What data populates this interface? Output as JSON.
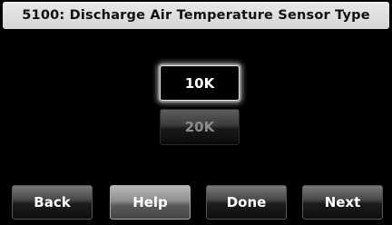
{
  "header": {
    "title": "5100: Discharge Air Temperature Sensor Type"
  },
  "options": [
    {
      "label": "10K",
      "selected": true
    },
    {
      "label": "20K",
      "selected": false
    }
  ],
  "footer": {
    "back_label": "Back",
    "help_label": "Help",
    "done_label": "Done",
    "next_label": "Next"
  }
}
